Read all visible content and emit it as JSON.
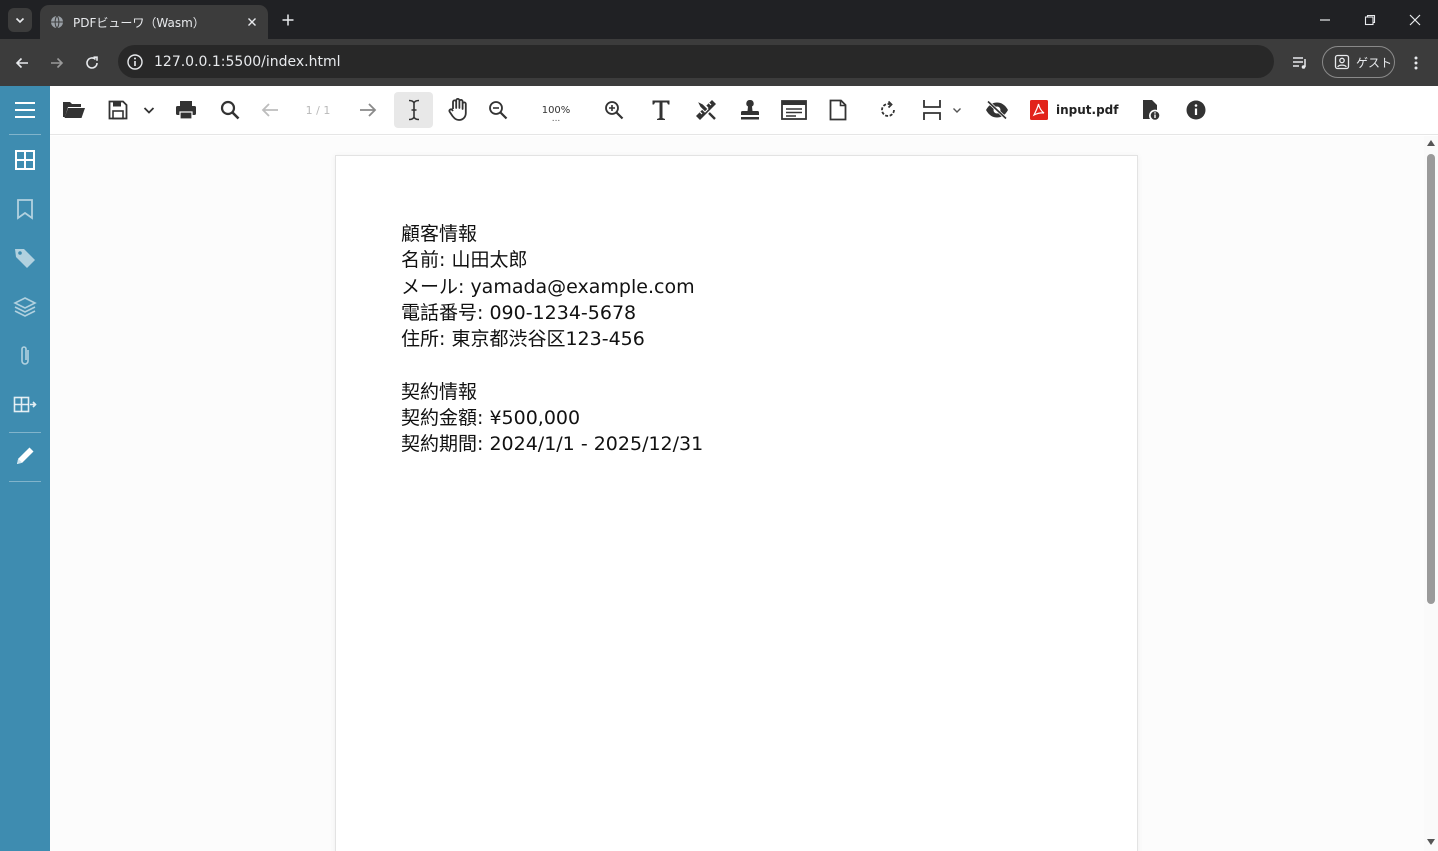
{
  "browser": {
    "tab_title": "PDFビューワ（Wasm）",
    "url": "127.0.0.1:5500/index.html",
    "profile_label": "ゲスト"
  },
  "viewer": {
    "page_indicator": "1 / 1",
    "zoom_level": "100%",
    "zoom_more": "...",
    "file_name": "input.pdf",
    "accent_color": "#3e8cb0"
  },
  "document": {
    "lines": [
      "顧客情報",
      "名前: 山田太郎",
      "メール: yamada@example.com",
      "電話番号: 090-1234-5678",
      "住所: 東京都渋谷区123-456",
      "",
      "契約情報",
      "契約金額: ¥500,000",
      "契約期間: 2024/1/1 - 2025/12/31"
    ]
  }
}
